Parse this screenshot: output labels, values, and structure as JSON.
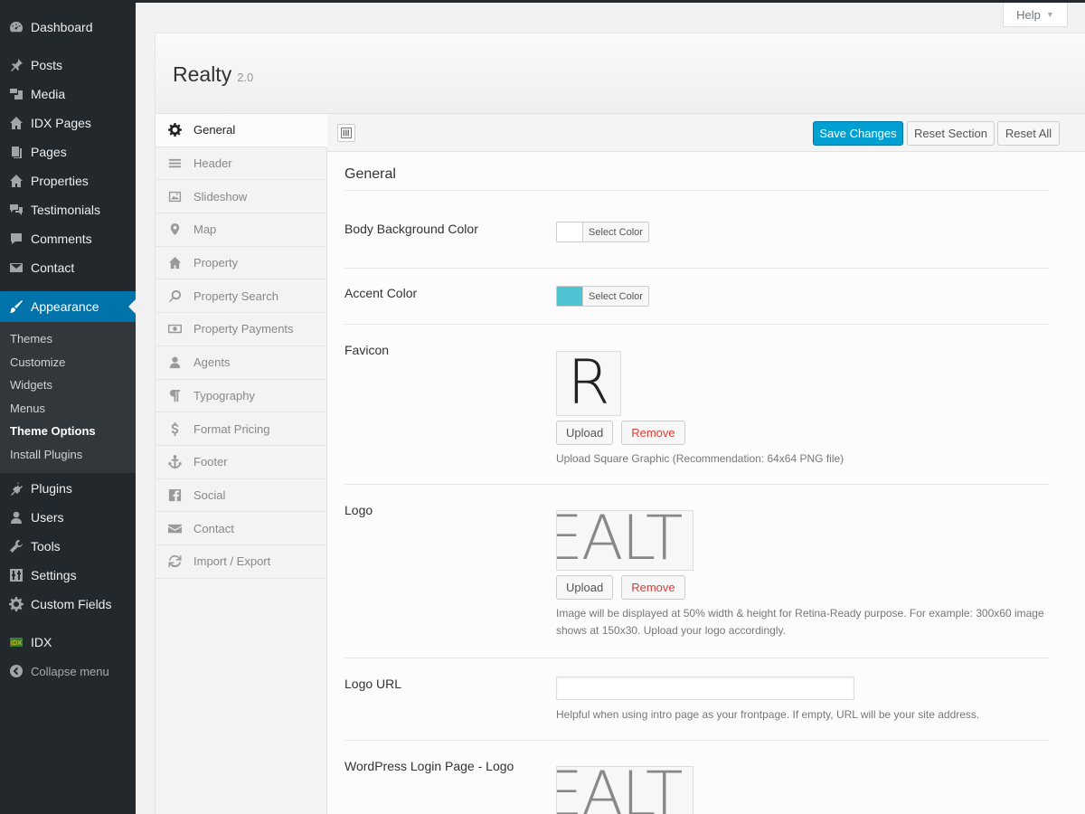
{
  "admin_menu": {
    "items_top": [
      {
        "label": "Dashboard",
        "icon": "dashboard-icon"
      },
      {
        "label": "Posts",
        "icon": "pin-icon"
      },
      {
        "label": "Media",
        "icon": "media-icon"
      },
      {
        "label": "IDX Pages",
        "icon": "home-icon"
      },
      {
        "label": "Pages",
        "icon": "page-icon"
      },
      {
        "label": "Properties",
        "icon": "home-icon"
      },
      {
        "label": "Testimonials",
        "icon": "testimonial-icon"
      },
      {
        "label": "Comments",
        "icon": "comment-icon"
      },
      {
        "label": "Contact",
        "icon": "mail-icon"
      }
    ],
    "current": {
      "label": "Appearance",
      "icon": "brush-icon"
    },
    "submenu": [
      "Themes",
      "Customize",
      "Widgets",
      "Menus",
      "Theme Options",
      "Install Plugins"
    ],
    "submenu_active": "Theme Options",
    "items_bottom": [
      {
        "label": "Plugins",
        "icon": "plugin-icon"
      },
      {
        "label": "Users",
        "icon": "user-icon"
      },
      {
        "label": "Tools",
        "icon": "wrench-icon"
      },
      {
        "label": "Settings",
        "icon": "settings-icon"
      },
      {
        "label": "Custom Fields",
        "icon": "gear-icon"
      }
    ],
    "idx": {
      "label": "IDX",
      "icon": "idx-logo-icon"
    },
    "collapse": {
      "label": "Collapse menu",
      "icon": "collapse-icon"
    }
  },
  "help": {
    "label": "Help"
  },
  "panel": {
    "title": "Realty",
    "version": "2.0",
    "tabs": [
      {
        "label": "General",
        "icon": "gear-icon"
      },
      {
        "label": "Header",
        "icon": "menu-icon"
      },
      {
        "label": "Slideshow",
        "icon": "image-icon"
      },
      {
        "label": "Map",
        "icon": "map-marker-icon"
      },
      {
        "label": "Property",
        "icon": "home-icon"
      },
      {
        "label": "Property Search",
        "icon": "search-icon"
      },
      {
        "label": "Property Payments",
        "icon": "money-icon"
      },
      {
        "label": "Agents",
        "icon": "user-icon"
      },
      {
        "label": "Typography",
        "icon": "paragraph-icon"
      },
      {
        "label": "Format Pricing",
        "icon": "dollar-icon"
      },
      {
        "label": "Footer",
        "icon": "anchor-icon"
      },
      {
        "label": "Social",
        "icon": "facebook-icon"
      },
      {
        "label": "Contact",
        "icon": "envelope-icon"
      },
      {
        "label": "Import / Export",
        "icon": "refresh-icon"
      }
    ],
    "active_tab": "General",
    "actions": {
      "save": "Save Changes",
      "reset_section": "Reset Section",
      "reset_all": "Reset All"
    }
  },
  "section": {
    "title": "General",
    "body_bg": {
      "label": "Body Background Color",
      "button": "Select Color",
      "color": "#ffffff"
    },
    "accent": {
      "label": "Accent Color",
      "button": "Select Color",
      "color": "#4fc3d1"
    },
    "favicon": {
      "label": "Favicon",
      "preview_letter": "R",
      "upload": "Upload",
      "remove": "Remove",
      "desc": "Upload Square Graphic (Recommendation: 64x64 PNG file)"
    },
    "logo": {
      "label": "Logo",
      "preview_text": "EALT",
      "upload": "Upload",
      "remove": "Remove",
      "desc": "Image will be displayed at 50% width & height for Retina-Ready purpose. For example: 300x60 image shows at 150x30. Upload your logo accordingly."
    },
    "logo_url": {
      "label": "Logo URL",
      "value": "",
      "desc": "Helpful when using intro page as your frontpage. If empty, URL will be your site address."
    },
    "login_logo": {
      "label": "WordPress Login Page - Logo",
      "preview_text": "EALT"
    }
  }
}
